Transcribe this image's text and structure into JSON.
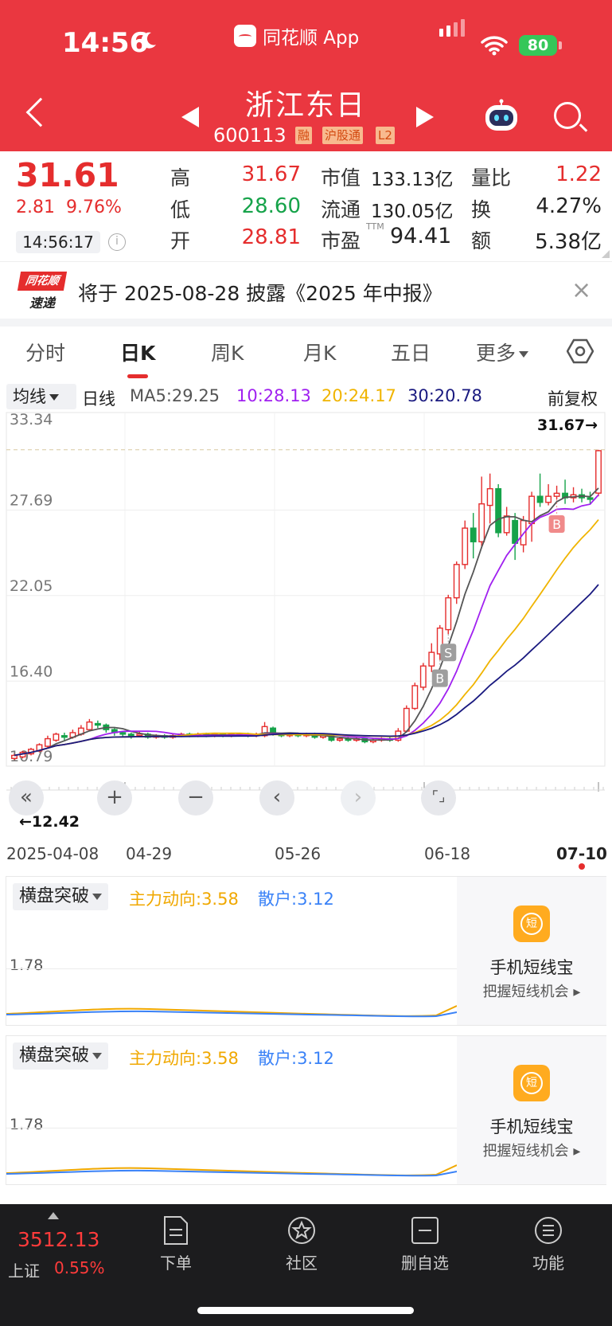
{
  "status_bar": {
    "time": "14:56",
    "app_label": "同花顺 App",
    "battery": "80"
  },
  "header": {
    "stock_name": "浙江东日",
    "stock_code": "600113",
    "tags": [
      "融",
      "沪股通",
      "L2"
    ]
  },
  "quote": {
    "price": "31.61",
    "change": "2.81",
    "change_pct": "9.76%",
    "time": "14:56:17",
    "high_label": "高",
    "high": "31.67",
    "low_label": "低",
    "low": "28.60",
    "open_label": "开",
    "open": "28.81",
    "mktcap_label": "市值",
    "mktcap": "133.13亿",
    "float_label": "流通",
    "float": "130.05亿",
    "pe_label": "市盈",
    "pe_sup": "TTM",
    "pe": "94.41",
    "vol_ratio_label": "量比",
    "vol_ratio": "1.22",
    "turnover_label": "换",
    "turnover": "4.27%",
    "amount_label": "额",
    "amount": "5.38亿"
  },
  "notice": {
    "logo_top": "同花顺",
    "logo_bottom": "速递",
    "text": "将于 2025-08-28 披露《2025 年中报》",
    "close": "×"
  },
  "tabs": [
    "分时",
    "日K",
    "周K",
    "月K",
    "五日",
    "更多"
  ],
  "ma_row": {
    "selector": "均线",
    "period": "日线",
    "ma5": "MA5:29.25",
    "ma10": "10:28.13",
    "ma20": "20:24.17",
    "ma30": "30:20.78",
    "adjust": "前复权"
  },
  "colors": {
    "red": "#e52d2d",
    "green": "#16a34a",
    "ma5": "#555555",
    "ma10": "#a020f0",
    "ma20": "#f0b400",
    "ma30": "#1a1a80"
  },
  "chart_data": {
    "type": "candlestick",
    "y_ticks": [
      "33.34",
      "27.69",
      "22.05",
      "16.40",
      "10.79"
    ],
    "ylim": [
      10.79,
      33.34
    ],
    "high_marker": "31.67→",
    "low_marker": "←12.42",
    "x_labels": [
      "2025-04-08",
      "04-29",
      "05-26",
      "06-18",
      "07-10"
    ],
    "signals": [
      {
        "label": "B",
        "index": 51
      },
      {
        "label": "S",
        "index": 52
      },
      {
        "label": "B",
        "index": 65
      }
    ],
    "candles": [
      [
        11.3,
        11.5,
        11.2,
        11.6
      ],
      [
        11.4,
        11.7,
        11.3,
        11.8
      ],
      [
        11.6,
        11.9,
        11.5,
        12.0
      ],
      [
        11.8,
        12.2,
        11.7,
        12.3
      ],
      [
        12.1,
        12.6,
        12.0,
        12.8
      ],
      [
        12.5,
        12.9,
        12.4,
        13.0
      ],
      [
        12.8,
        12.7,
        12.5,
        13.0
      ],
      [
        12.7,
        13.0,
        12.6,
        13.2
      ],
      [
        12.9,
        13.3,
        12.8,
        13.5
      ],
      [
        13.2,
        13.7,
        13.1,
        13.9
      ],
      [
        13.6,
        13.5,
        13.3,
        13.8
      ],
      [
        13.5,
        13.2,
        13.0,
        13.6
      ],
      [
        13.2,
        13.0,
        12.8,
        13.3
      ],
      [
        13.0,
        12.9,
        12.7,
        13.1
      ],
      [
        12.9,
        12.8,
        12.6,
        13.0
      ],
      [
        12.8,
        12.9,
        12.7,
        13.1
      ],
      [
        12.9,
        12.7,
        12.6,
        13.0
      ],
      [
        12.7,
        12.8,
        12.6,
        12.9
      ],
      [
        12.8,
        12.7,
        12.6,
        12.9
      ],
      [
        12.7,
        12.8,
        12.6,
        12.9
      ],
      [
        12.8,
        12.9,
        12.7,
        13.0
      ],
      [
        12.9,
        12.8,
        12.7,
        13.0
      ],
      [
        12.8,
        12.9,
        12.7,
        13.0
      ],
      [
        12.9,
        12.8,
        12.7,
        13.0
      ],
      [
        12.8,
        12.9,
        12.7,
        13.0
      ],
      [
        12.9,
        12.8,
        12.7,
        13.0
      ],
      [
        12.8,
        12.9,
        12.7,
        13.0
      ],
      [
        12.9,
        12.9,
        12.8,
        13.0
      ],
      [
        12.9,
        12.8,
        12.7,
        13.0
      ],
      [
        12.8,
        12.9,
        12.7,
        13.0
      ],
      [
        12.8,
        13.4,
        12.7,
        13.7
      ],
      [
        13.3,
        12.9,
        12.8,
        13.4
      ],
      [
        12.9,
        12.8,
        12.7,
        13.0
      ],
      [
        12.8,
        12.9,
        12.7,
        13.0
      ],
      [
        12.9,
        12.8,
        12.7,
        13.0
      ],
      [
        12.8,
        12.9,
        12.7,
        13.0
      ],
      [
        12.9,
        12.7,
        12.6,
        13.0
      ],
      [
        12.7,
        12.8,
        12.6,
        12.9
      ],
      [
        12.8,
        12.5,
        12.4,
        12.9
      ],
      [
        12.5,
        12.6,
        12.4,
        12.7
      ],
      [
        12.6,
        12.5,
        12.4,
        12.7
      ],
      [
        12.5,
        12.6,
        12.4,
        12.7
      ],
      [
        12.6,
        12.4,
        12.3,
        12.7
      ],
      [
        12.4,
        12.5,
        12.3,
        12.6
      ],
      [
        12.5,
        12.6,
        12.4,
        12.7
      ],
      [
        12.6,
        12.5,
        12.4,
        12.7
      ],
      [
        12.5,
        13.1,
        12.4,
        13.3
      ],
      [
        13.1,
        14.6,
        13.0,
        14.8
      ],
      [
        14.6,
        16.1,
        14.5,
        16.3
      ],
      [
        16.0,
        17.4,
        15.8,
        17.6
      ],
      [
        17.4,
        18.3,
        17.0,
        18.9
      ],
      [
        18.2,
        19.9,
        17.8,
        20.1
      ],
      [
        19.8,
        21.9,
        19.5,
        22.1
      ],
      [
        21.9,
        24.1,
        21.5,
        24.3
      ],
      [
        24.1,
        26.5,
        23.8,
        27.0
      ],
      [
        26.5,
        25.6,
        24.5,
        27.5
      ],
      [
        25.6,
        28.1,
        25.2,
        29.9
      ],
      [
        28.0,
        29.1,
        26.8,
        30.1
      ],
      [
        29.1,
        26.2,
        25.9,
        29.4
      ],
      [
        26.2,
        27.3,
        26.0,
        27.9
      ],
      [
        27.0,
        25.5,
        24.4,
        27.5
      ],
      [
        25.4,
        27.0,
        24.9,
        27.3
      ],
      [
        26.8,
        28.6,
        25.6,
        28.9
      ],
      [
        28.6,
        28.2,
        27.9,
        30.1
      ],
      [
        28.2,
        28.6,
        28.0,
        29.4
      ],
      [
        28.6,
        28.8,
        28.4,
        29.3
      ],
      [
        28.8,
        28.5,
        28.1,
        29.7
      ],
      [
        28.5,
        28.7,
        28.2,
        29.2
      ],
      [
        28.7,
        28.5,
        28.2,
        29.1
      ],
      [
        28.5,
        28.4,
        28.1,
        28.9
      ],
      [
        28.81,
        31.61,
        28.6,
        31.67
      ]
    ]
  },
  "chart_controls": [
    "«",
    "+",
    "−",
    "‹",
    "›",
    "⌜⌟"
  ],
  "indicator": {
    "selector": "横盘突破",
    "main": "主力动向:3.58",
    "retail": "散户:3.12",
    "value": "1.78",
    "promo_icon": "短",
    "promo_title": "手机短线宝",
    "promo_sub": "把握短线机会 ▸"
  },
  "bottom": {
    "index_value": "3512.13",
    "index_name": "上证",
    "index_pct": "0.55%",
    "nav": [
      "下单",
      "社区",
      "删自选",
      "功能"
    ]
  }
}
